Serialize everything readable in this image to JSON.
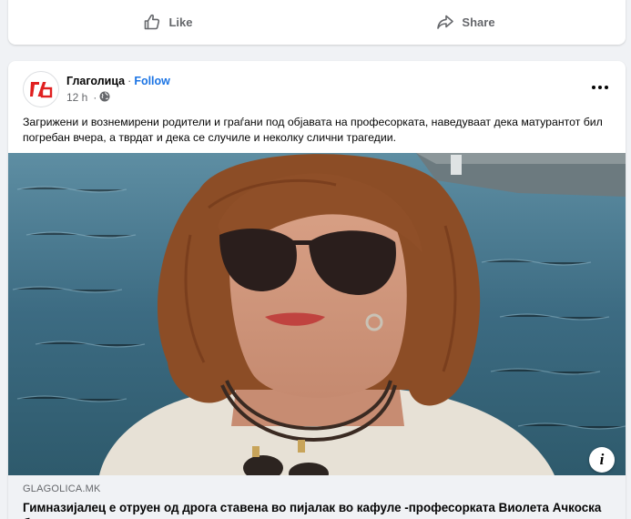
{
  "previous_post": {
    "like_label": "Like",
    "share_label": "Share"
  },
  "post": {
    "page_name": "Глаголица",
    "separator": "·",
    "follow_label": "Follow",
    "time": "12 h",
    "privacy_icon": "globe-icon",
    "more_icon": "more-options-icon",
    "avatar_logo_text": "Го",
    "text": "Загрижени и вознемирени родители и граѓани под објавата на професорката, наведуваат дека матурантот бил погребан вчера, а тврдат и дека се случиле и неколку слични трагедии.",
    "link": {
      "domain": "GLAGOLICA.MK",
      "title": "Гимназијалец е отруен од дрога ставена во пијалак во кафуле -професорката Виолета Ачкоска бара да не се прикрива страшната вистина",
      "info_label": "i"
    }
  },
  "colors": {
    "accent": "#1b74e4",
    "logo_red": "#e02020",
    "muted": "#65676b"
  }
}
